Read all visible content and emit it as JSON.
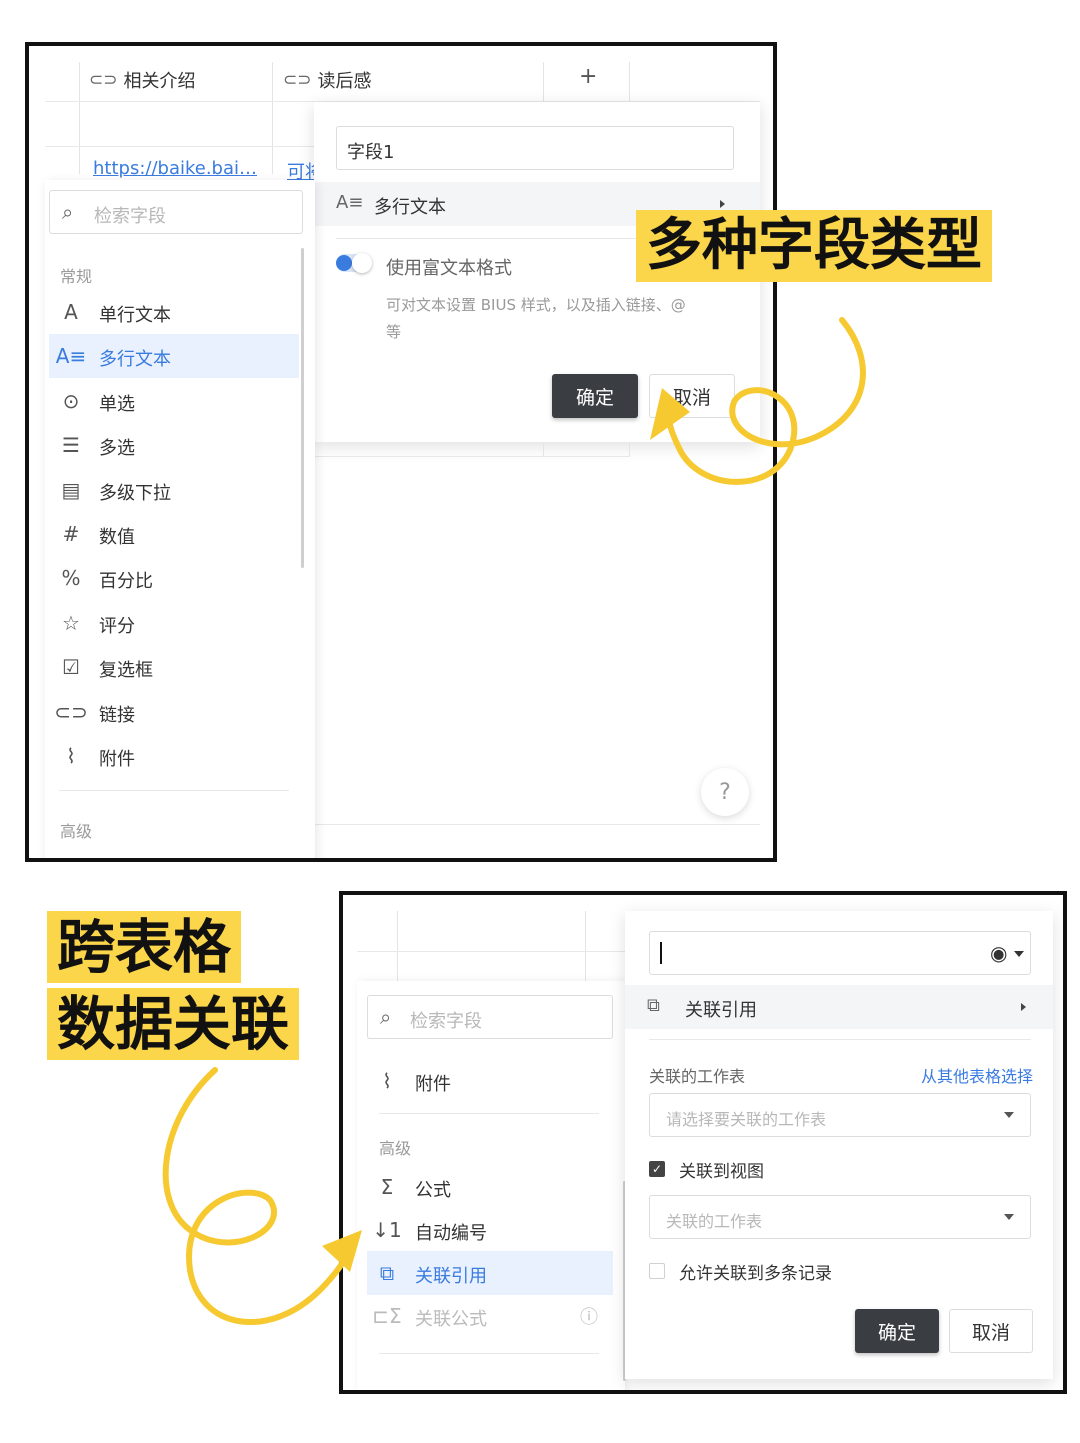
{
  "callouts": {
    "top": "多种字段类型",
    "bottom_line1": "跨表格",
    "bottom_line2": "数据关联"
  },
  "shot1": {
    "columns": [
      "相关介绍",
      "读后感"
    ],
    "add_column": "+",
    "cell_link": "https://baike.bai…",
    "cell_partial": "可将",
    "field_name_value": "字段1",
    "field_type": "多行文本",
    "rich_text_label": "使用富文本格式",
    "rich_text_desc_line1": "可对文本设置 BIUS 样式，以及插入链接、@",
    "rich_text_desc_line2": "等",
    "ok": "确定",
    "cancel": "取消",
    "help": "?",
    "search_placeholder": "检索字段",
    "group_general": "常规",
    "group_advanced": "高级",
    "menu": [
      {
        "label": "单行文本",
        "icon": "single-line-text-icon",
        "glyph": "A"
      },
      {
        "label": "多行文本",
        "icon": "multi-line-text-icon",
        "glyph": "A≡"
      },
      {
        "label": "单选",
        "icon": "single-select-icon",
        "glyph": "⊙"
      },
      {
        "label": "多选",
        "icon": "multi-select-icon",
        "glyph": "☰"
      },
      {
        "label": "多级下拉",
        "icon": "cascade-dropdown-icon",
        "glyph": "▤"
      },
      {
        "label": "数值",
        "icon": "number-icon",
        "glyph": "#"
      },
      {
        "label": "百分比",
        "icon": "percent-icon",
        "glyph": "%"
      },
      {
        "label": "评分",
        "icon": "star-icon",
        "glyph": "☆"
      },
      {
        "label": "复选框",
        "icon": "checkbox-icon",
        "glyph": "☑"
      },
      {
        "label": "链接",
        "icon": "link-icon",
        "glyph": "⊂⊃"
      },
      {
        "label": "附件",
        "icon": "paperclip-icon",
        "glyph": "⌇"
      }
    ]
  },
  "shot2": {
    "search_placeholder": "检索字段",
    "attachment": "附件",
    "group_advanced": "高级",
    "menu": [
      {
        "label": "公式",
        "icon": "sigma-icon",
        "glyph": "Σ"
      },
      {
        "label": "自动编号",
        "icon": "auto-number-icon",
        "glyph": "↓1"
      },
      {
        "label": "关联引用",
        "icon": "link-reference-icon",
        "glyph": "⧉"
      },
      {
        "label": "关联公式",
        "icon": "link-formula-icon",
        "glyph": "⊏Σ"
      }
    ],
    "field_type": "关联引用",
    "linked_sheet_label": "关联的工作表",
    "choose_from_other": "从其他表格选择",
    "linked_sheet_placeholder": "请选择要关联的工作表",
    "link_to_view": "关联到视图",
    "view_placeholder": "关联的工作表",
    "allow_multi": "允许关联到多条记录",
    "ok": "确定",
    "cancel": "取消"
  },
  "colors": {
    "accent_blue": "#3a7be0",
    "callout_yellow": "#fbd54a",
    "ok_button": "#3a3d42",
    "selected_row": "#e8f1fd"
  }
}
